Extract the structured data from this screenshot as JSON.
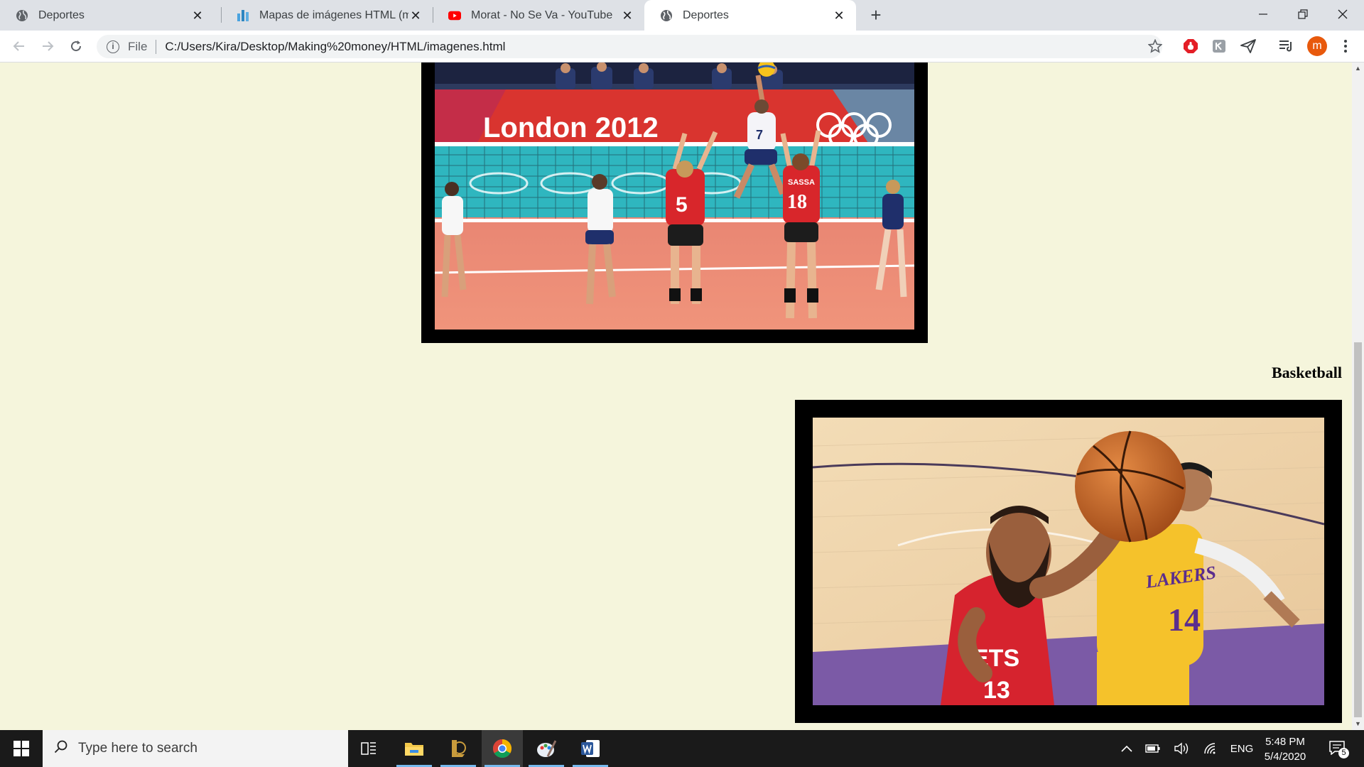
{
  "browser": {
    "tabs": [
      {
        "title": "Deportes",
        "favicon": "globe-icon",
        "active": false
      },
      {
        "title": "Mapas de imágenes HTML (map",
        "favicon": "site-logo-icon",
        "active": false
      },
      {
        "title": "Morat - No Se Va - YouTube",
        "favicon": "youtube-icon",
        "active": false
      },
      {
        "title": "Deportes",
        "favicon": "globe-icon",
        "active": true
      }
    ],
    "tab_close_glyph": "✕",
    "new_tab_glyph": "+",
    "address": {
      "scheme_label": "File",
      "url": "C:/Users/Kira/Desktop/Making%20money/HTML/imagenes.html"
    },
    "profile_initial": "m",
    "accent_colors": {
      "profile": "#e8590c",
      "youtube": "#ff0000",
      "extension_red": "#e41e26"
    }
  },
  "page": {
    "background": "#f5f5dc",
    "sections": [
      {
        "heading": "",
        "image_alt": "Volleyball match at London 2012",
        "banner_text": "London 2012",
        "jersey_numbers": [
          "5",
          "18",
          "7"
        ],
        "jersey_name": "SASSA"
      },
      {
        "heading": "Basketball",
        "image_alt": "Basketball players reaching for the ball",
        "jersey_numbers": [
          "13",
          "14"
        ],
        "jersey_texts": [
          "LAKERS",
          "ETS"
        ]
      }
    ]
  },
  "taskbar": {
    "search_placeholder": "Type here to search",
    "apps": [
      "task-view-icon",
      "file-explorer-icon",
      "league-client-icon",
      "chrome-icon",
      "paint-icon",
      "word-icon"
    ],
    "tray": {
      "language": "ENG",
      "time": "5:48 PM",
      "date": "5/4/2020",
      "notification_count": "5"
    }
  }
}
